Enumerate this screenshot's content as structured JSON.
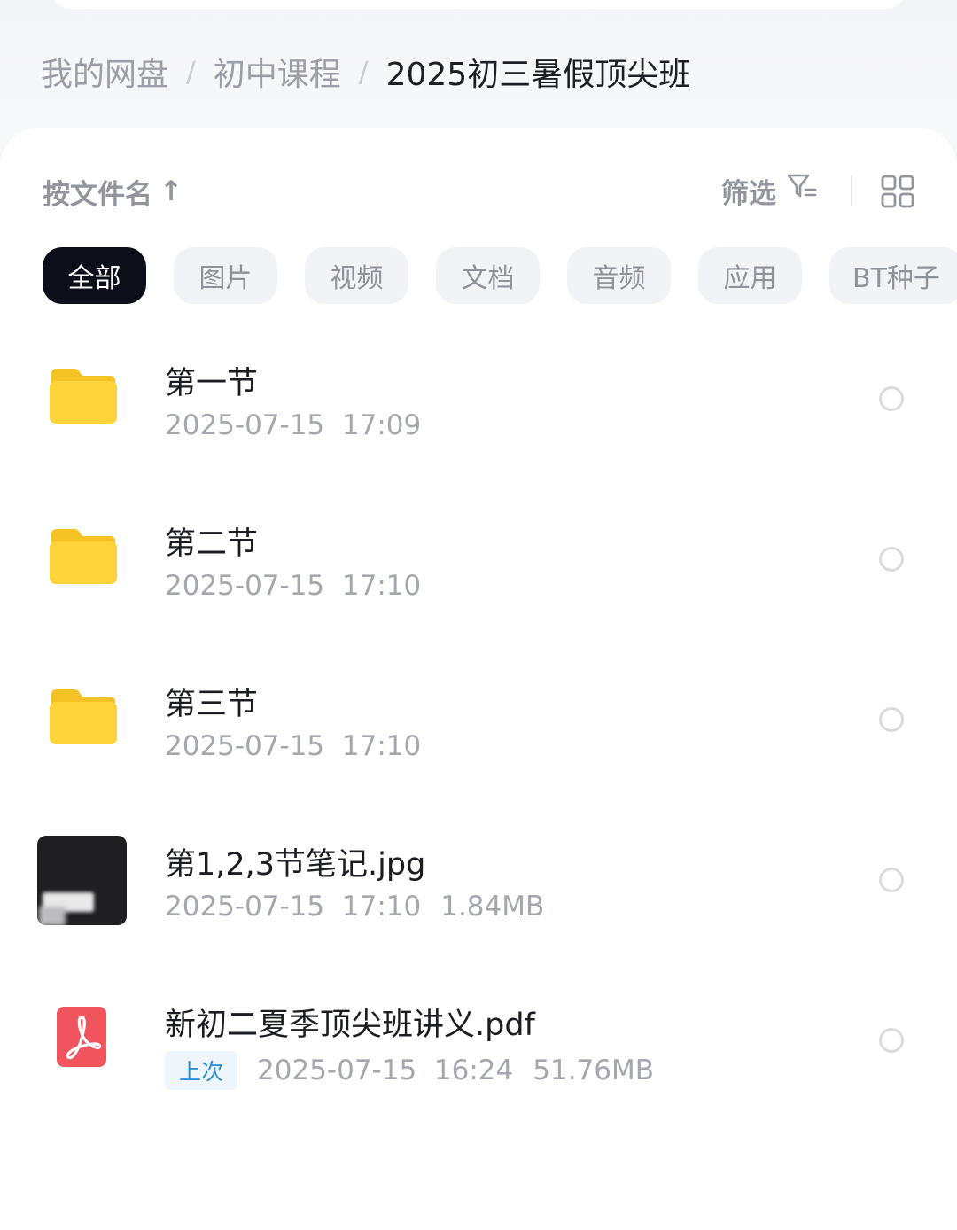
{
  "breadcrumb": {
    "items": [
      "我的网盘",
      "初中课程"
    ],
    "separator": "/",
    "current": "2025初三暑假顶尖班"
  },
  "toolbar": {
    "sort_label": "按文件名",
    "sort_arrow": "↑",
    "filter_label": "筛选",
    "filter_icon": "filter-icon",
    "view_icon": "grid-view-icon"
  },
  "chips": [
    "全部",
    "图片",
    "视频",
    "文档",
    "音频",
    "应用",
    "BT种子"
  ],
  "active_chip": "全部",
  "files": [
    {
      "type": "folder",
      "name": "第一节",
      "date": "2025-07-15",
      "time": "17:09"
    },
    {
      "type": "folder",
      "name": "第二节",
      "date": "2025-07-15",
      "time": "17:10"
    },
    {
      "type": "folder",
      "name": "第三节",
      "date": "2025-07-15",
      "time": "17:10"
    },
    {
      "type": "image",
      "name": "第1,2,3节笔记.jpg",
      "date": "2025-07-15",
      "time": "17:10",
      "size": "1.84MB"
    },
    {
      "type": "pdf",
      "name": "新初二夏季顶尖班讲义.pdf",
      "tag": "上次",
      "date": "2025-07-15",
      "time": "16:24",
      "size": "51.76MB"
    }
  ],
  "colors": {
    "folder": "#FFD43B",
    "pdf": "#F0555F",
    "active_chip_bg": "#0C0F1A",
    "tag_text": "#2C8FD6"
  }
}
